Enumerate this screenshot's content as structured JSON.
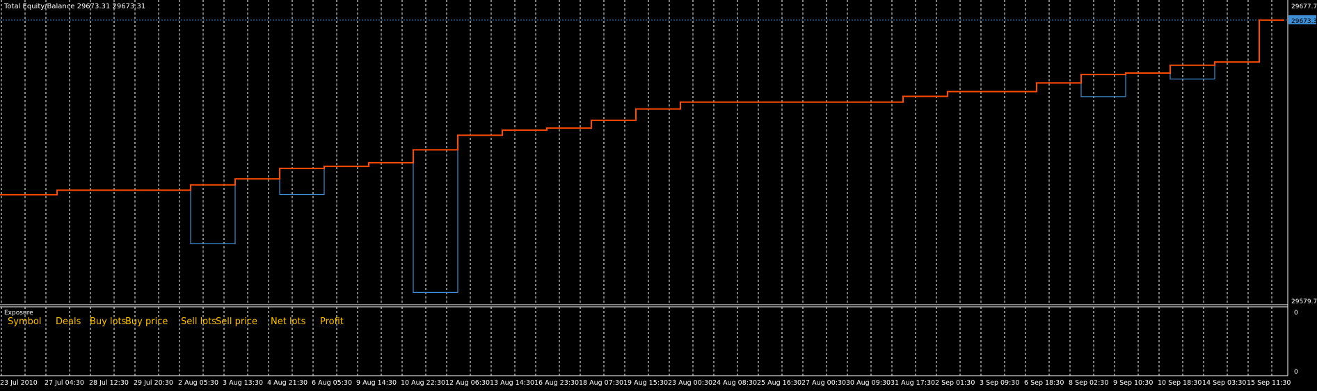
{
  "main_panel": {
    "title": "Total Equity/Balance 29673.31 29673.31",
    "price_labels": {
      "top": "29677.7",
      "current": "29673.3",
      "bottom": "29579.74"
    }
  },
  "exposure_panel": {
    "title": "Exposure",
    "headers": [
      "Symbol",
      "Deals",
      "Buy lots",
      "Buy price",
      "Sell lots",
      "Sell price",
      "Net lots",
      "Profit"
    ],
    "scale_labels": {
      "top": "0",
      "bottom": "0"
    }
  },
  "time_axis": {
    "labels": [
      "23 Jul 2010",
      "27 Jul 04:30",
      "28 Jul 12:30",
      "29 Jul 20:30",
      "2 Aug 05:30",
      "3 Aug 13:30",
      "4 Aug 21:30",
      "6 Aug 05:30",
      "9 Aug 14:30",
      "10 Aug 22:30",
      "12 Aug 06:30",
      "13 Aug 14:30",
      "16 Aug 23:30",
      "18 Aug 07:30",
      "19 Aug 15:30",
      "23 Aug 00:30",
      "24 Aug 08:30",
      "25 Aug 16:30",
      "27 Aug 00:30",
      "30 Aug 09:30",
      "31 Aug 17:30",
      "2 Sep 01:30",
      "3 Sep 09:30",
      "6 Sep 18:30",
      "8 Sep 02:30",
      "9 Sep 10:30",
      "10 Sep 18:30",
      "14 Sep 03:30",
      "15 Sep 11:30"
    ]
  },
  "colors": {
    "background": "#000000",
    "balance": "#ff4a00",
    "equity": "#3f8fd6",
    "grid": "#ffffff",
    "current_level": "#3f8fd6",
    "exposure_text": "#ffc000"
  },
  "chart_data": {
    "type": "line",
    "ylim": [
      29579.74,
      29677.7
    ],
    "current_value": 29673.31,
    "series": [
      {
        "name": "Balance",
        "x": [
          "23 Jul 2010",
          "27 Jul 04:30",
          "28 Jul 12:30",
          "29 Jul 20:30",
          "2 Aug 05:30",
          "3 Aug 13:30",
          "4 Aug 21:30",
          "6 Aug 05:30",
          "9 Aug 14:30",
          "10 Aug 22:30",
          "12 Aug 06:30",
          "13 Aug 14:30",
          "16 Aug 23:30",
          "18 Aug 07:30",
          "19 Aug 15:30",
          "23 Aug 00:30",
          "24 Aug 08:30",
          "25 Aug 16:30",
          "27 Aug 00:30",
          "30 Aug 09:30",
          "31 Aug 17:30",
          "2 Sep 01:30",
          "3 Sep 09:30",
          "6 Sep 18:30",
          "8 Sep 02:30",
          "9 Sep 10:30",
          "10 Sep 18:30",
          "14 Sep 03:30",
          "15 Sep 11:30"
        ],
        "values": [
          29614.9,
          29616.4,
          29616.4,
          29616.4,
          29618.2,
          29620.2,
          29623.7,
          29624.4,
          29625.6,
          29629.9,
          29634.8,
          29636.5,
          29637.2,
          29639.8,
          29643.6,
          29645.9,
          29645.9,
          29645.9,
          29645.9,
          29645.9,
          29647.8,
          29649.4,
          29649.4,
          29652.3,
          29655.1,
          29655.6,
          29658.2,
          29659.3,
          29673.3
        ]
      },
      {
        "name": "Equity",
        "x": [
          "23 Jul 2010",
          "27 Jul 04:30",
          "28 Jul 12:30",
          "29 Jul 20:30",
          "2 Aug 05:30",
          "3 Aug 13:30",
          "4 Aug 21:30",
          "6 Aug 05:30",
          "9 Aug 14:30",
          "10 Aug 22:30",
          "12 Aug 06:30",
          "13 Aug 14:30",
          "16 Aug 23:30",
          "18 Aug 07:30",
          "19 Aug 15:30",
          "23 Aug 00:30",
          "24 Aug 08:30",
          "25 Aug 16:30",
          "27 Aug 00:30",
          "30 Aug 09:30",
          "31 Aug 17:30",
          "2 Sep 01:30",
          "3 Sep 09:30",
          "6 Sep 18:30",
          "8 Sep 02:30",
          "9 Sep 10:30",
          "10 Sep 18:30",
          "14 Sep 03:30",
          "15 Sep 11:30"
        ],
        "values": [
          29614.9,
          29616.4,
          29616.4,
          29616.4,
          29598.5,
          29620.2,
          29615.0,
          29624.4,
          29625.6,
          29582.2,
          29634.8,
          29636.5,
          29637.2,
          29639.8,
          29643.6,
          29645.9,
          29645.9,
          29645.9,
          29645.9,
          29645.9,
          29647.8,
          29649.4,
          29649.4,
          29652.3,
          29647.7,
          29655.6,
          29653.6,
          29659.3,
          29673.3
        ]
      }
    ]
  }
}
